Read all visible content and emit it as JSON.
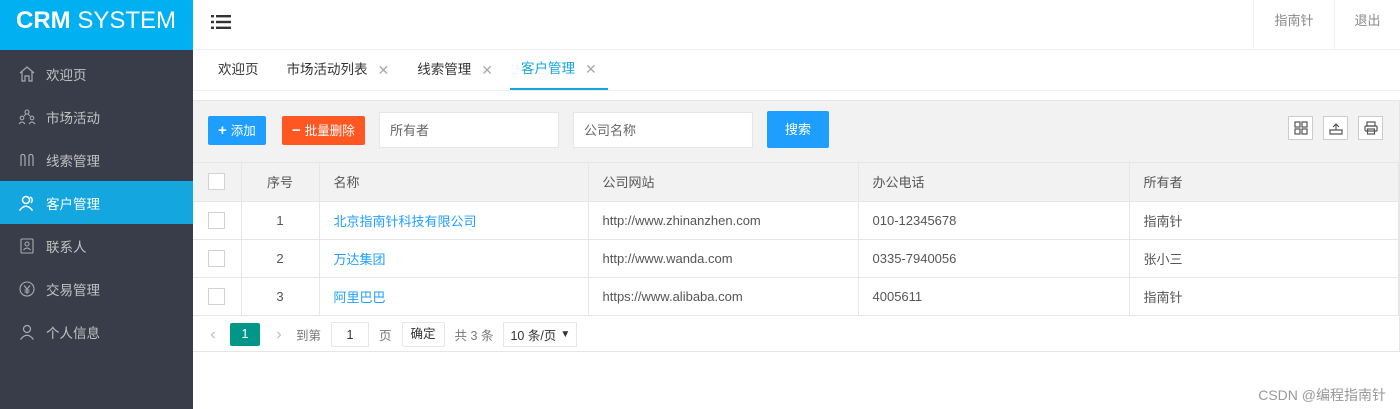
{
  "app": {
    "logo_bold": "CRM",
    "logo_rest": " SYSTEM"
  },
  "sidebar": {
    "items": [
      {
        "label": "欢迎页",
        "icon": "home-icon",
        "active": false
      },
      {
        "label": "市场活动",
        "icon": "campaign-icon",
        "active": false
      },
      {
        "label": "线索管理",
        "icon": "leads-icon",
        "active": false
      },
      {
        "label": "客户管理",
        "icon": "customer-icon",
        "active": true
      },
      {
        "label": "联系人",
        "icon": "contacts-icon",
        "active": false
      },
      {
        "label": "交易管理",
        "icon": "transaction-icon",
        "active": false
      },
      {
        "label": "个人信息",
        "icon": "user-icon",
        "active": false
      }
    ]
  },
  "header": {
    "guide_label": "指南针",
    "logout_label": "退出"
  },
  "tabs": [
    {
      "label": "欢迎页",
      "closable": false
    },
    {
      "label": "市场活动列表",
      "closable": true
    },
    {
      "label": "线索管理",
      "closable": true
    },
    {
      "label": "客户管理",
      "closable": true,
      "active": true
    }
  ],
  "toolbar": {
    "add_label": "添加",
    "batch_delete_label": "批量删除",
    "owner_placeholder": "所有者",
    "company_placeholder": "公司名称",
    "search_label": "搜索"
  },
  "table": {
    "headers": {
      "no": "序号",
      "name": "名称",
      "website": "公司网站",
      "phone": "办公电话",
      "owner": "所有者"
    },
    "rows": [
      {
        "no": "1",
        "name": "北京指南针科技有限公司",
        "website": "http://www.zhinanzhen.com",
        "phone": "010-12345678",
        "owner": "指南针"
      },
      {
        "no": "2",
        "name": "万达集团",
        "website": "http://www.wanda.com",
        "phone": "0335-7940056",
        "owner": "张小三"
      },
      {
        "no": "3",
        "name": "阿里巴巴",
        "website": "https://www.alibaba.com",
        "phone": "4005611",
        "owner": "指南针"
      }
    ]
  },
  "pager": {
    "current_page": "1",
    "goto_label": "到第",
    "goto_value": "1",
    "page_unit": "页",
    "confirm_label": "确定",
    "total_label": "共 3 条",
    "page_size": "10 条/页"
  },
  "watermark": "CSDN @编程指南针",
  "colors": {
    "sidebar_bg": "#393d49",
    "logo_bg": "#00b0f0",
    "active_blue": "#14a6de",
    "primary_btn": "#1e9fff",
    "danger_btn": "#ff5722",
    "pager_active": "#009688"
  }
}
